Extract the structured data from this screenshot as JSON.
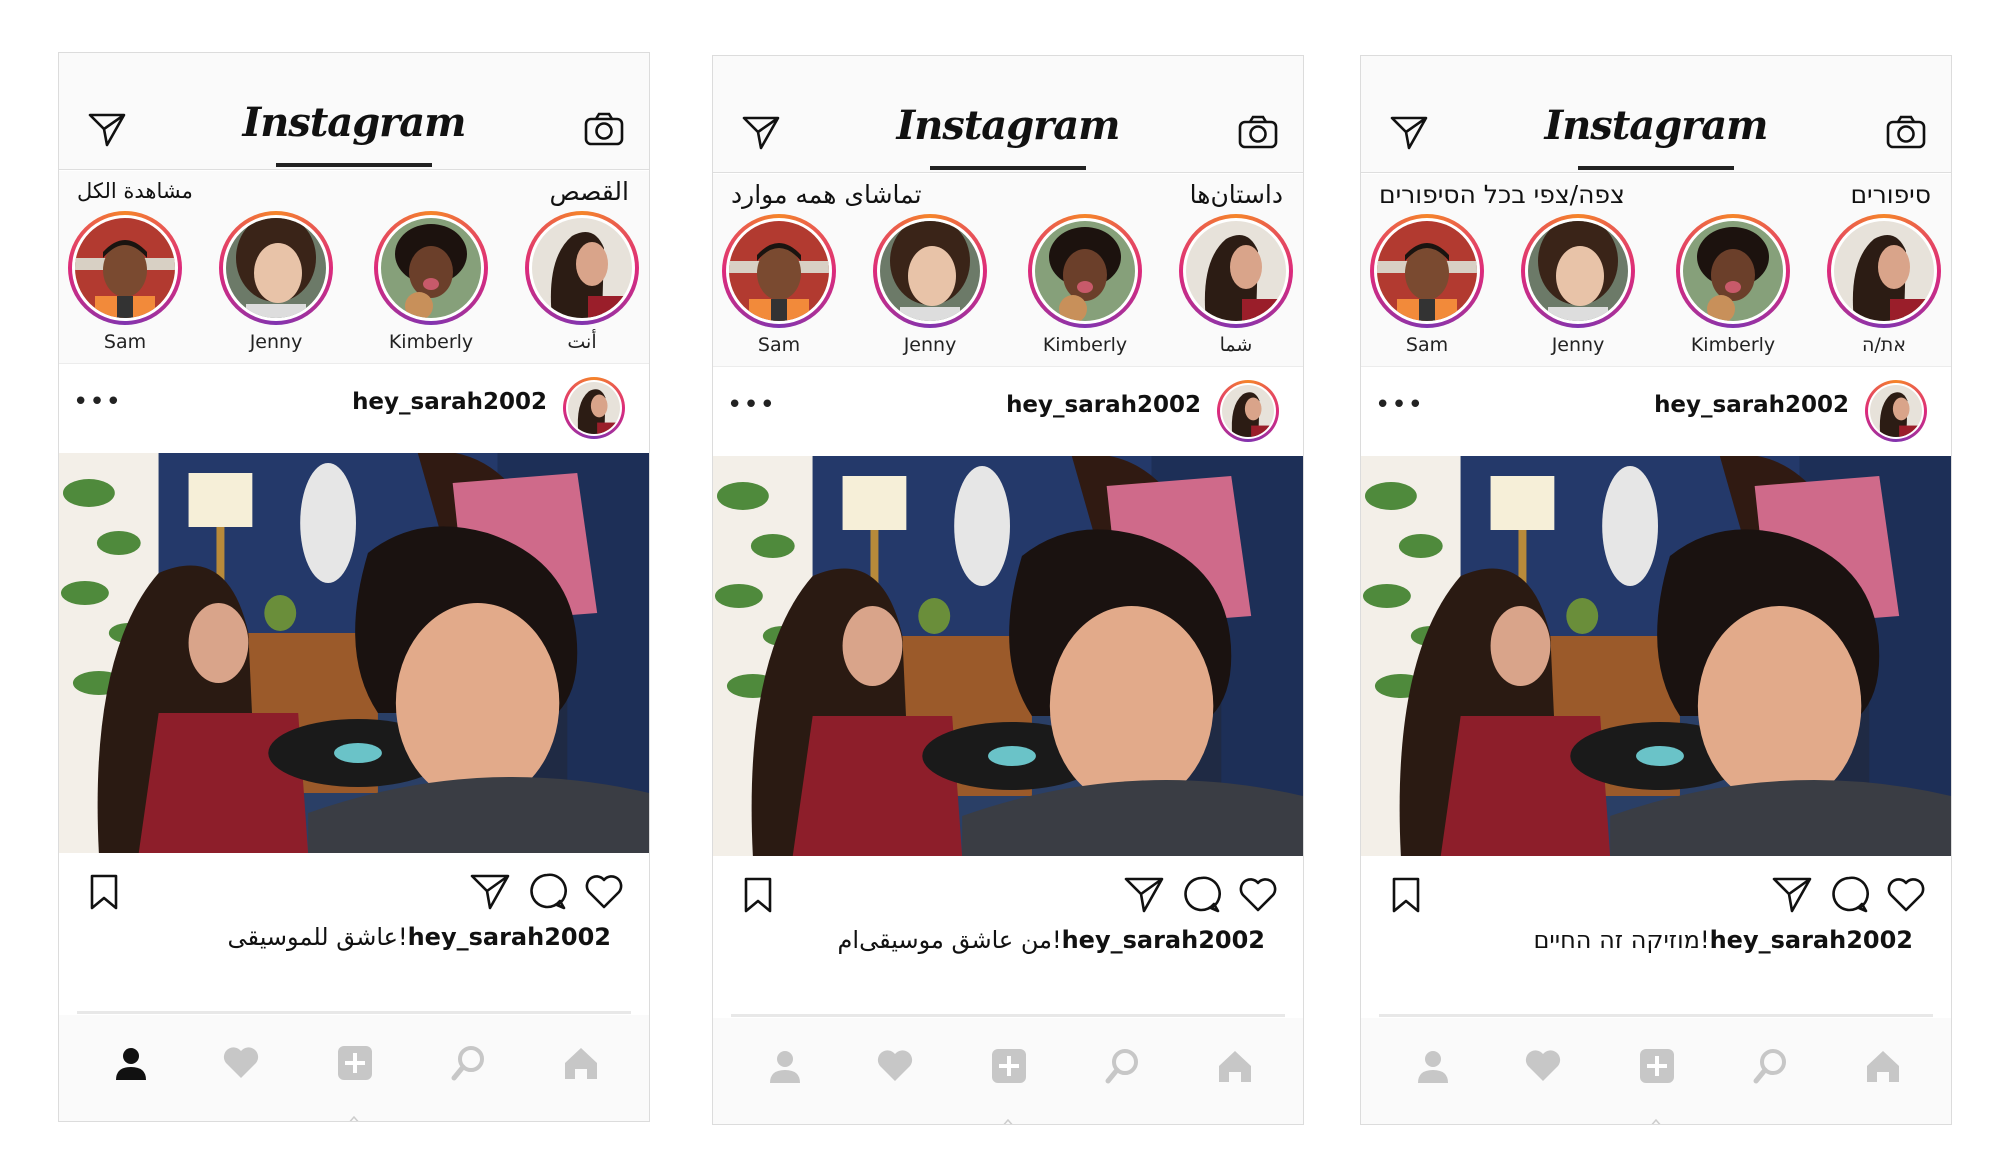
{
  "colors": {
    "story_ring": "#dd2a7b",
    "tab_inactive": "#c7c7c7",
    "tab_active": "#111111"
  },
  "phones": [
    {
      "app_title": "Instagram",
      "stories_title": "القصص",
      "see_all": "مشاهدة الكل",
      "stories": [
        "أنت",
        "Kimberly",
        "Jenny",
        "Sam"
      ],
      "post_user": "hey_sarah2002",
      "caption_user": "hey_sarah2002",
      "caption_text": "عاشق للموسيقى!",
      "active_tab": "profile"
    },
    {
      "app_title": "Instagram",
      "stories_title": "داستان‌ها",
      "see_all": "تماشای همه موارد",
      "stories": [
        "شما",
        "Kimberly",
        "Jenny",
        "Sam"
      ],
      "post_user": "hey_sarah2002",
      "caption_user": "hey_sarah2002",
      "caption_text": "من عاشق موسیقی‌ام!",
      "active_tab": "none"
    },
    {
      "app_title": "Instagram",
      "stories_title": "סיפורים",
      "see_all": "צפה/צפי בכל הסיפורים",
      "stories": [
        "את/ה",
        "Kimberly",
        "Jenny",
        "Sam"
      ],
      "post_user": "hey_sarah2002",
      "caption_user": "hey_sarah2002",
      "caption_text": "מוזיקה זה החיים!",
      "active_tab": "none"
    }
  ],
  "icons": [
    "direct-message-icon",
    "camera-icon",
    "more-options-icon",
    "bookmark-icon",
    "share-icon",
    "comment-icon",
    "heart-icon",
    "profile-tab-icon",
    "activity-tab-icon",
    "new-post-tab-icon",
    "search-tab-icon",
    "home-tab-icon"
  ]
}
